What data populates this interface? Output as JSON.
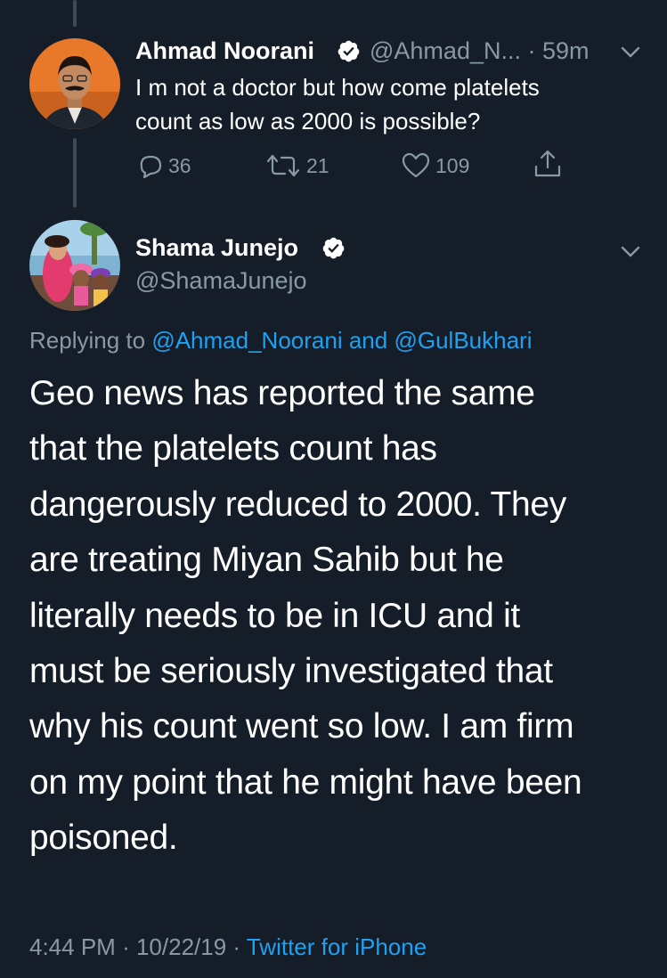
{
  "reply_tweet": {
    "author_name": "Ahmad Noorani",
    "handle": "@Ahmad_N...",
    "separator": "·",
    "time": "59m",
    "text_line1": "I m not a doctor but how come platelets",
    "text_line2": "count as low as 2000 is possible?",
    "reply_count": "36",
    "retweet_count": "21",
    "like_count": "109"
  },
  "main_tweet": {
    "author_name": "Shama Junejo",
    "handle": "@ShamaJunejo",
    "replying_prefix": "Replying to",
    "replying_user1": "@Ahmad_Noorani",
    "replying_and": "and",
    "replying_user2": "@GulBukhari",
    "text_lines": [
      "Geo news has reported the same",
      "that the platelets count has",
      "dangerously reduced to 2000. They",
      "are treating Miyan Sahib but he",
      "literally needs to be in ICU and it",
      "must be seriously investigated that",
      "why his count went so low. I am firm",
      "on my point that he might have been",
      "poisoned."
    ],
    "time": "4:44 PM",
    "dot1": "·",
    "date": "10/22/19",
    "dot2": "·",
    "source": "Twitter for iPhone"
  },
  "icons": {
    "verified": "verified-badge-icon",
    "chevron": "chevron-down-icon",
    "reply": "reply-icon",
    "retweet": "retweet-icon",
    "like": "heart-icon",
    "share": "share-icon"
  },
  "colors": {
    "background": "#151d29",
    "muted": "#8899a6",
    "link": "#1da1f2",
    "text": "#ffffff"
  }
}
